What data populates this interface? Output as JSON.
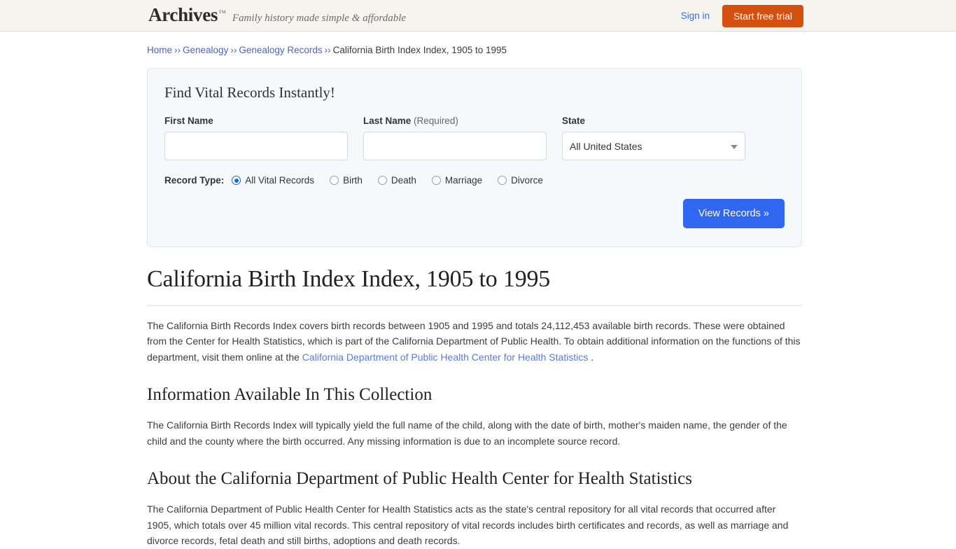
{
  "header": {
    "logo": "Archives",
    "logo_tm": "™",
    "tagline": "Family history made simple & affordable",
    "signin_label": "Sign in",
    "trial_label": "Start free trial",
    "trial_color": "#d4500f",
    "link_color": "#3b6fd4"
  },
  "breadcrumb": {
    "separator": "››",
    "items": [
      {
        "label": "Home",
        "link": true
      },
      {
        "label": "Genealogy",
        "link": true
      },
      {
        "label": "Genealogy Records",
        "link": true
      },
      {
        "label": "California Birth Index Index, 1905 to 1995",
        "link": false
      }
    ]
  },
  "search_panel": {
    "title": "Find Vital Records Instantly!",
    "first_name": {
      "label": "First Name",
      "value": "",
      "placeholder": ""
    },
    "last_name": {
      "label": "Last Name",
      "required_note": "(Required)",
      "value": "",
      "placeholder": ""
    },
    "state": {
      "label": "State",
      "selected": "All United States",
      "caret_icon": "chevron-down-icon"
    },
    "record_type": {
      "label": "Record Type:",
      "selected": "All Vital Records",
      "options": [
        "All Vital Records",
        "Birth",
        "Death",
        "Marriage",
        "Divorce"
      ]
    },
    "submit_label": "View Records »",
    "submit_color": "#3067f0"
  },
  "article": {
    "title": "California Birth Index Index, 1905 to 1995",
    "intro_before_link": "The California Birth Records Index covers birth records between 1905 and 1995 and totals 24,112,453 available birth records. These were obtained from the Center for Health Statistics, which is part of the California Department of Public Health. To obtain additional information on the functions of this department, visit them online at the ",
    "intro_link": "California Department of Public Health Center for Health Statistics",
    "intro_after_link": " .",
    "sections": [
      {
        "heading": "Information Available In This Collection",
        "text": "The California Birth Records Index will typically yield the full name of the child, along with the date of birth, mother's maiden name, the gender of the child and the county where the birth occurred. Any missing information is due to an incomplete source record."
      },
      {
        "heading": "About the California Department of Public Health Center for Health Statistics",
        "text": "The California Department of Public Health Center for Health Statistics acts as the state's central repository for all vital records that occurred after 1905, which totals over 45 million vital records. This central repository of vital records includes birth certificates and records, as well as marriage and divorce records, fetal death and still births, adoptions and death records."
      }
    ]
  }
}
